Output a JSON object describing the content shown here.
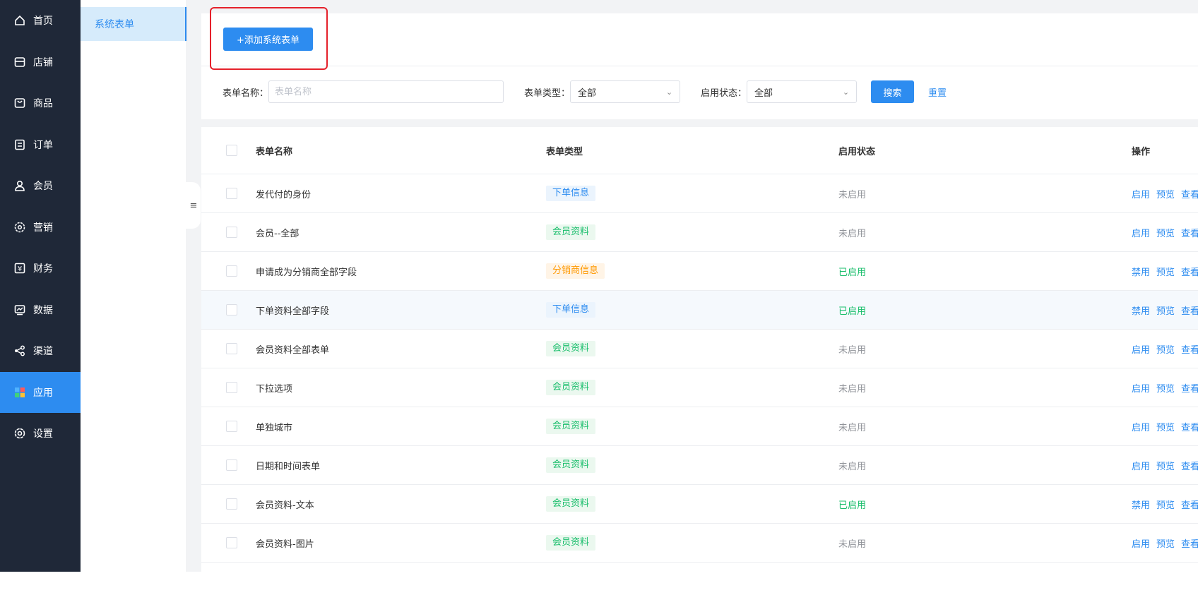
{
  "nav": {
    "items": [
      {
        "label": "首页",
        "icon": "home-icon"
      },
      {
        "label": "店铺",
        "icon": "store-icon"
      },
      {
        "label": "商品",
        "icon": "bag-icon"
      },
      {
        "label": "订单",
        "icon": "order-icon"
      },
      {
        "label": "会员",
        "icon": "user-icon"
      },
      {
        "label": "营销",
        "icon": "marketing-icon"
      },
      {
        "label": "财务",
        "icon": "yuan-icon"
      },
      {
        "label": "数据",
        "icon": "chart-icon"
      },
      {
        "label": "渠道",
        "icon": "share-icon"
      },
      {
        "label": "应用",
        "icon": "apps-icon",
        "active": true
      },
      {
        "label": "设置",
        "icon": "gear-icon"
      }
    ]
  },
  "subnav": {
    "items": [
      {
        "label": "系统表单",
        "active": true
      }
    ]
  },
  "toolbar": {
    "add_label": "+添加系统表单"
  },
  "filters": {
    "name_label": "表单名称：",
    "name_placeholder": "表单名称",
    "type_label": "表单类型：",
    "type_value": "全部",
    "status_label": "启用状态：",
    "status_value": "全部",
    "search_label": "搜索",
    "reset_label": "重置"
  },
  "table": {
    "headers": {
      "name": "表单名称",
      "type": "表单类型",
      "status": "启用状态",
      "ops": "操作"
    },
    "rows": [
      {
        "name": "发代付的身份",
        "type": "下单信息",
        "type_color": "blue",
        "status": "未启用",
        "enabled": false,
        "action": "启用",
        "preview": "预览",
        "view": "查看"
      },
      {
        "name": "会员--全部",
        "type": "会员资料",
        "type_color": "green",
        "status": "未启用",
        "enabled": false,
        "action": "启用",
        "preview": "预览",
        "view": "查看"
      },
      {
        "name": "申请成为分销商全部字段",
        "type": "分销商信息",
        "type_color": "orange",
        "status": "已启用",
        "enabled": true,
        "action": "禁用",
        "preview": "预览",
        "view": "查看"
      },
      {
        "name": "下单资料全部字段",
        "type": "下单信息",
        "type_color": "blue",
        "status": "已启用",
        "enabled": true,
        "action": "禁用",
        "preview": "预览",
        "view": "查看",
        "highlighted": true
      },
      {
        "name": "会员资料全部表单",
        "type": "会员资料",
        "type_color": "green",
        "status": "未启用",
        "enabled": false,
        "action": "启用",
        "preview": "预览",
        "view": "查看"
      },
      {
        "name": "下拉选项",
        "type": "会员资料",
        "type_color": "green",
        "status": "未启用",
        "enabled": false,
        "action": "启用",
        "preview": "预览",
        "view": "查看"
      },
      {
        "name": "单独城市",
        "type": "会员资料",
        "type_color": "green",
        "status": "未启用",
        "enabled": false,
        "action": "启用",
        "preview": "预览",
        "view": "查看"
      },
      {
        "name": "日期和时间表单",
        "type": "会员资料",
        "type_color": "green",
        "status": "未启用",
        "enabled": false,
        "action": "启用",
        "preview": "预览",
        "view": "查看"
      },
      {
        "name": "会员资料-文本",
        "type": "会员资料",
        "type_color": "green",
        "status": "已启用",
        "enabled": true,
        "action": "禁用",
        "preview": "预览",
        "view": "查看"
      },
      {
        "name": "会员资料-图片",
        "type": "会员资料",
        "type_color": "green",
        "status": "未启用",
        "enabled": false,
        "action": "启用",
        "preview": "预览",
        "view": "查看"
      }
    ]
  },
  "colors": {
    "primary": "#2d8cf0",
    "sidebar": "#1f2838",
    "success": "#19be6b",
    "warning": "#ff9900",
    "highlight_box": "#e5212b"
  }
}
